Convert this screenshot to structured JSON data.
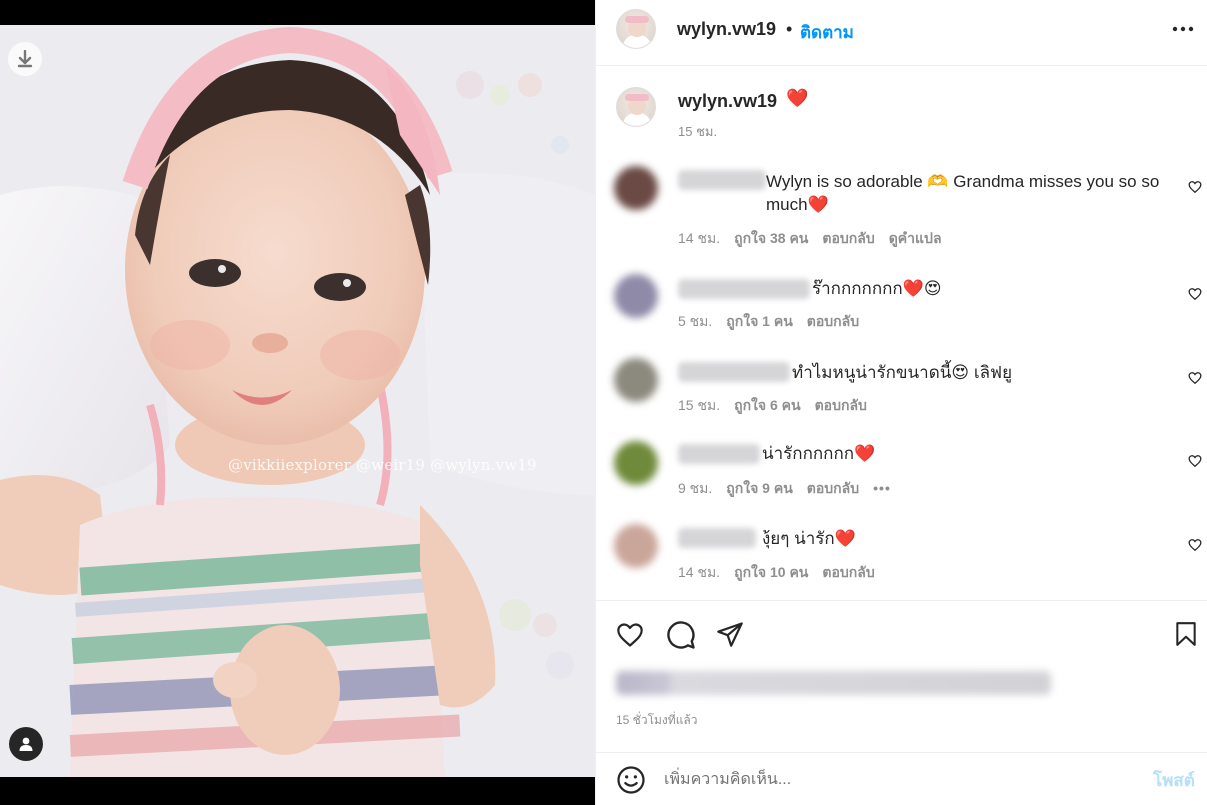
{
  "post": {
    "username": "wylyn.vw19",
    "follow_label": "ติดตาม",
    "dot": "•",
    "caption_emoji": "❤️",
    "caption_time": "15 ชม.",
    "watermark": "@vikkiiexplorer @weir19 @wylyn.vw19"
  },
  "comments": [
    {
      "text": "Wylyn is so adorable 🫶 Grandma misses you so so much❤️",
      "time": "14 ชม.",
      "likes": "ถูกใจ 38 คน",
      "reply": "ตอบกลับ",
      "translate": "ดูคำแปล"
    },
    {
      "text": "ร๊ากกกกกกก❤️😍",
      "time": "5 ชม.",
      "likes": "ถูกใจ 1 คน",
      "reply": "ตอบกลับ"
    },
    {
      "text": "ทำไมหนูน่ารักขนาดนี้😍 เลิฟยู",
      "time": "15 ชม.",
      "likes": "ถูกใจ 6 คน",
      "reply": "ตอบกลับ"
    },
    {
      "text": "น่ารักกกกกก❤️",
      "time": "9 ชม.",
      "likes": "ถูกใจ 9 คน",
      "reply": "ตอบกลับ",
      "more": "•••"
    },
    {
      "text": "งุ้ยๆ น่ารัก❤️",
      "time": "14 ชม.",
      "likes": "ถูกใจ 10 คน",
      "reply": "ตอบกลับ"
    }
  ],
  "footer": {
    "post_time": "15 ชั่วโมงที่แล้ว",
    "comment_placeholder": "เพิ่มความคิดเห็น...",
    "post_label": "โพสต์"
  },
  "colors": {
    "accent": "#0095f6",
    "post_disabled": "#b2dffc",
    "muted": "#8e8e8e"
  },
  "icons": [
    "download-icon",
    "user-tag-icon",
    "more-options-icon",
    "heart-icon",
    "comment-icon",
    "share-icon",
    "bookmark-icon",
    "emoji-icon"
  ]
}
